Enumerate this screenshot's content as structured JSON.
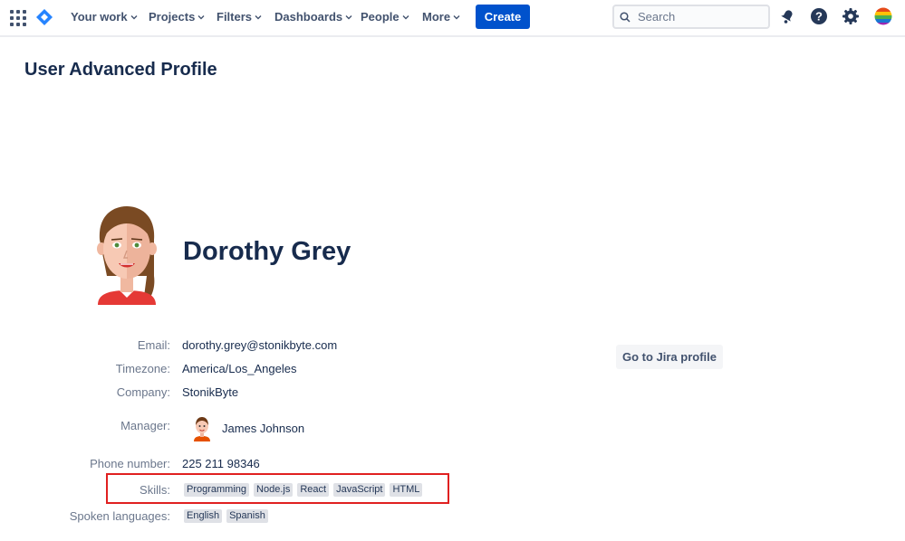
{
  "nav": {
    "items": [
      {
        "label": "Your work"
      },
      {
        "label": "Projects"
      },
      {
        "label": "Filters"
      },
      {
        "label": "Dashboards"
      },
      {
        "label": "People"
      },
      {
        "label": "More"
      }
    ],
    "create_label": "Create",
    "search_placeholder": "Search"
  },
  "page": {
    "title": "User Advanced Profile"
  },
  "profile": {
    "name": "Dorothy Grey",
    "email_label": "Email:",
    "email": "dorothy.grey@stonikbyte.com",
    "timezone_label": "Timezone:",
    "timezone": "America/Los_Angeles",
    "company_label": "Company:",
    "company": "StonikByte",
    "manager_label": "Manager:",
    "manager": "James Johnson",
    "phone_label": "Phone number:",
    "phone": "225 211 98346",
    "skills_label": "Skills:",
    "skills": [
      "Programming",
      "Node.js",
      "React",
      "JavaScript",
      "HTML"
    ],
    "languages_label": "Spoken languages:",
    "languages": [
      "English",
      "Spanish"
    ],
    "jira_button": "Go to Jira profile"
  },
  "colors": {
    "primary": "#0052CC",
    "text": "#172B4D",
    "muted": "#6B778C",
    "highlight": "#E02020"
  }
}
